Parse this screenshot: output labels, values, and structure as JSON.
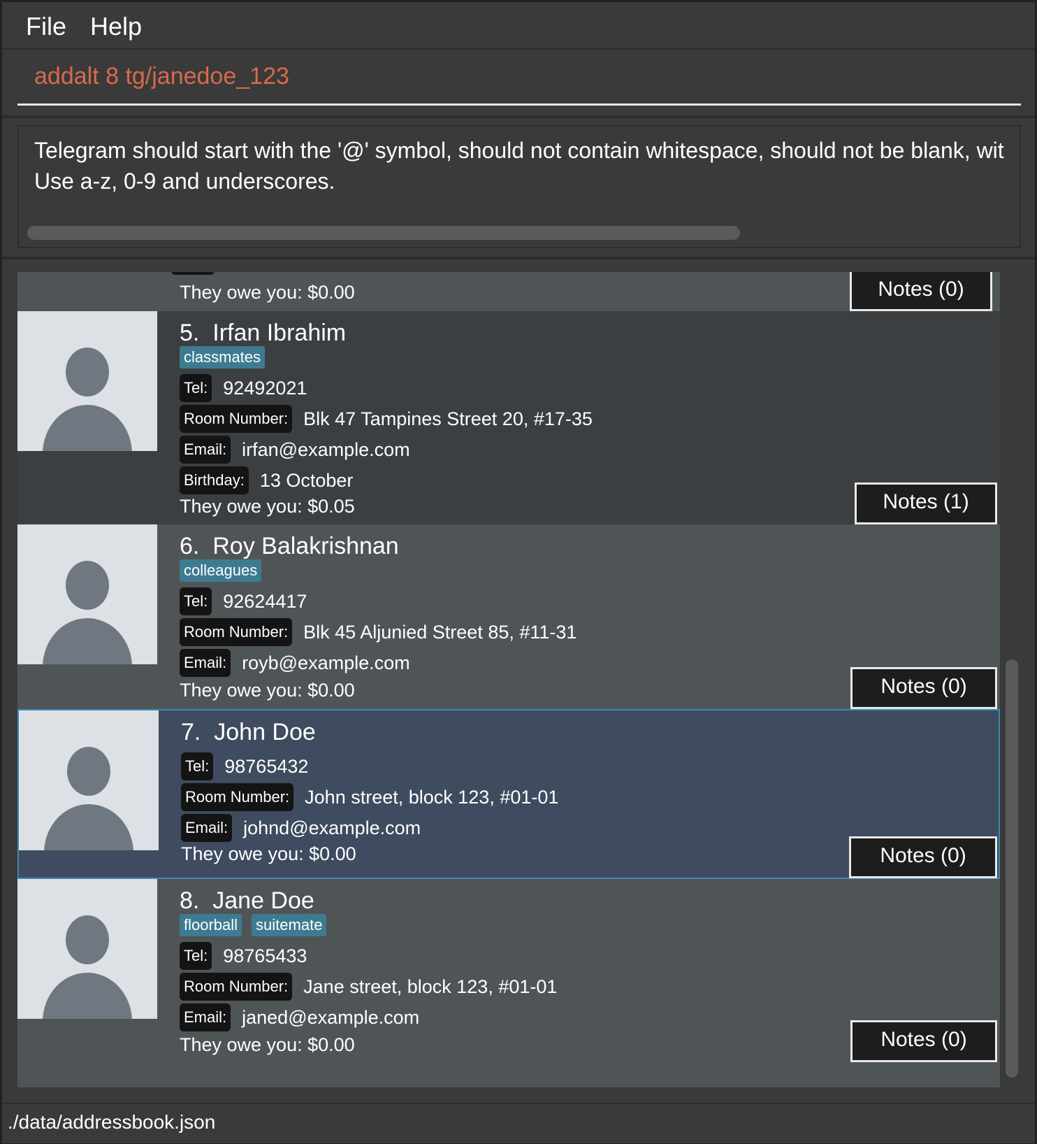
{
  "menu": {
    "file": "File",
    "help": "Help"
  },
  "command": {
    "value": "addalt 8 tg/janedoe_123"
  },
  "result": {
    "text": "Telegram should start with the '@' symbol, should not contain whitespace, should not be blank, wit\nUse a-z, 0-9 and underscores."
  },
  "list": {
    "partial": {
      "owe": "They owe you: $0.00",
      "notes": "Notes (0)"
    },
    "persons": [
      {
        "name": "5.  Irfan Ibrahim",
        "tags": [
          "classmates"
        ],
        "tel_label": "Tel:",
        "tel": "92492021",
        "room_label": "Room Number:",
        "room": "Blk 47 Tampines Street 20, #17-35",
        "email_label": "Email:",
        "email": "irfan@example.com",
        "birthday_label": "Birthday:",
        "birthday": "13 October",
        "owe": "They owe you: $0.05",
        "notes": "Notes (1)"
      },
      {
        "name": "6.  Roy Balakrishnan",
        "tags": [
          "colleagues"
        ],
        "tel_label": "Tel:",
        "tel": "92624417",
        "room_label": "Room Number:",
        "room": "Blk 45 Aljunied Street 85, #11-31",
        "email_label": "Email:",
        "email": "royb@example.com",
        "owe": "They owe you: $0.00",
        "notes": "Notes (0)"
      },
      {
        "name": "7.  John Doe",
        "tags": [],
        "tel_label": "Tel:",
        "tel": "98765432",
        "room_label": "Room Number:",
        "room": "John street, block 123, #01-01",
        "email_label": "Email:",
        "email": "johnd@example.com",
        "owe": "They owe you: $0.00",
        "notes": "Notes (0)"
      },
      {
        "name": "8.  Jane Doe",
        "tags": [
          "floorball",
          "suitemate"
        ],
        "tel_label": "Tel:",
        "tel": "98765433",
        "room_label": "Room Number:",
        "room": "Jane street, block 123, #01-01",
        "email_label": "Email:",
        "email": "janed@example.com",
        "owe": "They owe you: $0.00",
        "notes": "Notes (0)"
      }
    ]
  },
  "status": {
    "path": "./data/addressbook.json"
  }
}
